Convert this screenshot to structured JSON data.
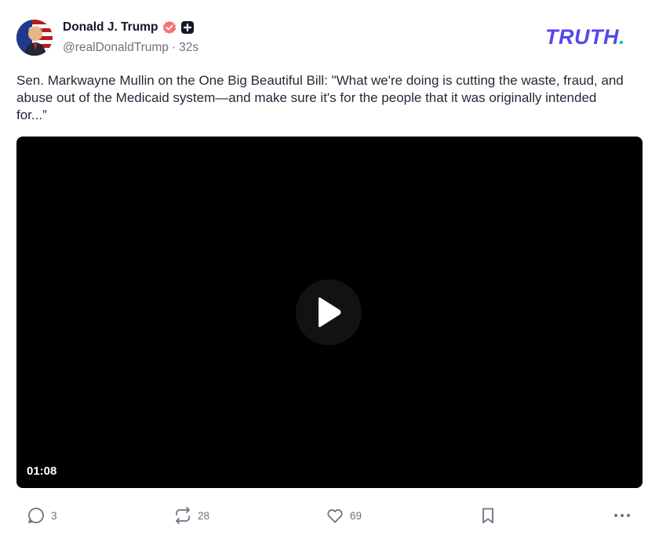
{
  "post": {
    "author": {
      "display_name": "Donald J. Trump",
      "handle": "@realDonaldTrump",
      "separator": "·",
      "time": "32s",
      "verified_color": "#f87171",
      "badge": "plus-square-icon"
    },
    "brand": {
      "logo": "TRUTH.",
      "logo_text": "TRUTH",
      "logo_dot": ".",
      "color": "#5448ee",
      "dot_color": "#0ec5c5"
    },
    "text": "Sen. Markwayne Mullin on the One Big Beautiful Bill: \"What we're doing is cutting the waste, fraud, and abuse out of the Medicaid system—and make sure it's for the people that it was originally intended for...”",
    "video": {
      "duration": "01:08",
      "play_icon": "play-icon"
    },
    "actions": {
      "replies": "3",
      "retruths": "28",
      "likes": "69",
      "reply_icon": "reply-icon",
      "retruth_icon": "retruth-icon",
      "like_icon": "heart-icon",
      "bookmark_icon": "bookmark-icon",
      "more_icon": "more-icon"
    }
  }
}
